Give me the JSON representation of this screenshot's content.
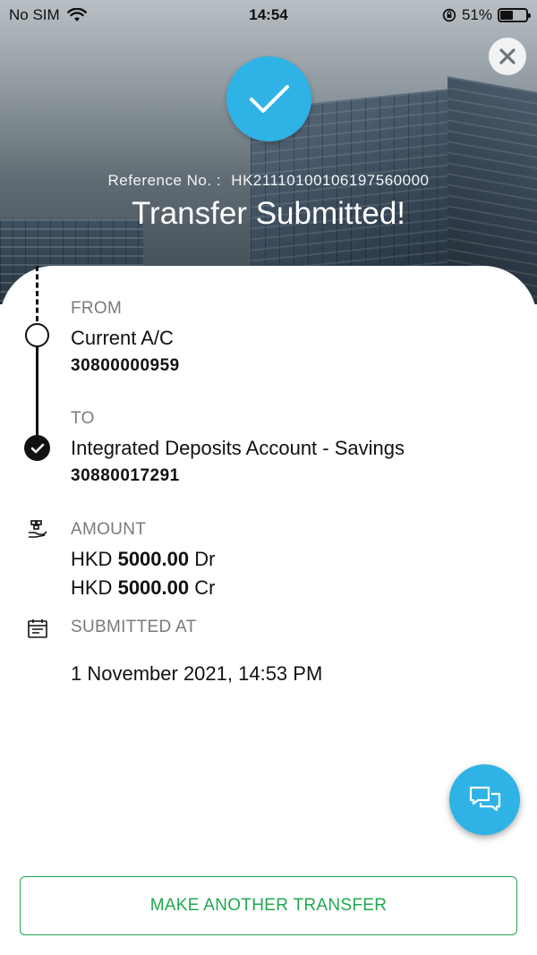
{
  "status_bar": {
    "carrier": "No SIM",
    "time": "14:54",
    "battery_text": "51%",
    "battery_level": 0.51
  },
  "header": {
    "reference_label": "Reference No. :",
    "reference_number": "HK21110100106197560000",
    "title": "Transfer Submitted!"
  },
  "from": {
    "label": "FROM",
    "account_name": "Current A/C",
    "account_number": "30800000959"
  },
  "to": {
    "label": "TO",
    "account_name": "Integrated Deposits Account - Savings",
    "account_number": "30880017291"
  },
  "amount": {
    "label": "AMOUNT",
    "debit": {
      "currency": "HKD",
      "value": "5000.00",
      "suffix": "Dr"
    },
    "credit": {
      "currency": "HKD",
      "value": "5000.00",
      "suffix": "Cr"
    }
  },
  "submitted": {
    "label": "SUBMITTED AT",
    "datetime": "1 November 2021, 14:53 PM"
  },
  "actions": {
    "primary_label": "MAKE ANOTHER TRANSFER"
  },
  "icons": {
    "close": "close-icon",
    "success": "checkmark-icon",
    "amount": "money-hand-icon",
    "calendar": "calendar-icon",
    "chat": "chat-bubbles-icon"
  },
  "colors": {
    "accent_blue": "#2fb3e6",
    "action_green": "#1fa84f"
  }
}
